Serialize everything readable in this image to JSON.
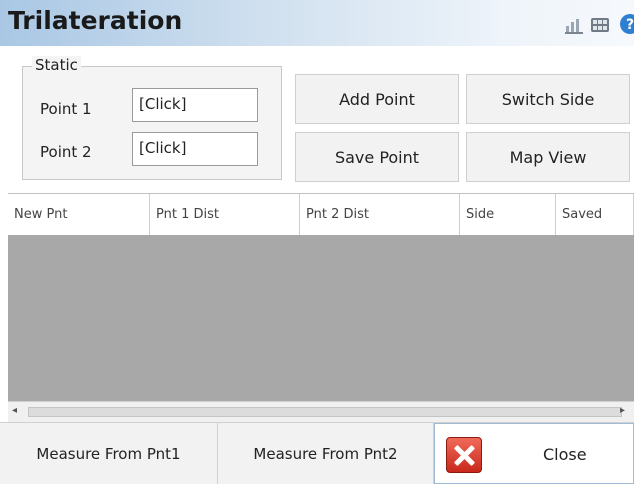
{
  "window": {
    "title": "Trilateration"
  },
  "title_icons": [
    "bar-chart-icon",
    "keyboard-icon",
    "help-icon"
  ],
  "static_group": {
    "label": "Static",
    "point1": {
      "label": "Point 1",
      "value": "[Click]"
    },
    "point2": {
      "label": "Point 2",
      "value": "[Click]"
    }
  },
  "buttons": {
    "add_point": "Add Point",
    "switch_side": "Switch Side",
    "save_point": "Save Point",
    "map_view": "Map View"
  },
  "table": {
    "columns": [
      "New Pnt",
      "Pnt 1 Dist",
      "Pnt 2 Dist",
      "Side",
      "Saved"
    ],
    "rows": []
  },
  "bottom_bar": {
    "measure_from_pnt1": "Measure From Pnt1",
    "measure_from_pnt2": "Measure From Pnt2",
    "close": "Close"
  },
  "colors": {
    "title_gradient_start": "#a9c7e4",
    "grid_background": "#a8a8a8",
    "close_icon": "#d93a2b"
  }
}
